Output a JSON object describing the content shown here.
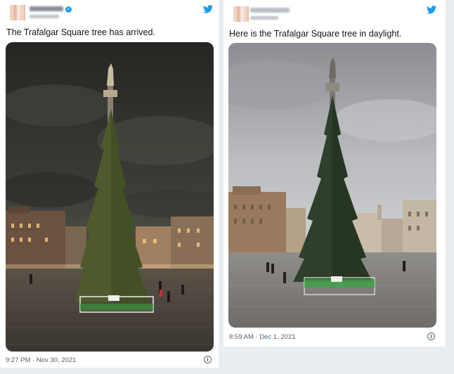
{
  "tweets": [
    {
      "text": "The Trafalgar Square tree has arrived.",
      "timestamp": "9:27 PM · Nov 30, 2021",
      "photo": "night-photo-trafalgar-tree"
    },
    {
      "text": "Here is the Trafalgar Square tree in daylight.",
      "timestamp": "8:59 AM · Dec 1, 2021",
      "photo": "daylight-photo-trafalgar-tree"
    }
  ],
  "icons": {
    "brand": "twitter-bird-icon",
    "verified": "verified-badge-icon",
    "info": "info-icon"
  },
  "colors": {
    "twitter_blue": "#1d9bf0",
    "text": "#0f1419",
    "meta": "#536471"
  }
}
